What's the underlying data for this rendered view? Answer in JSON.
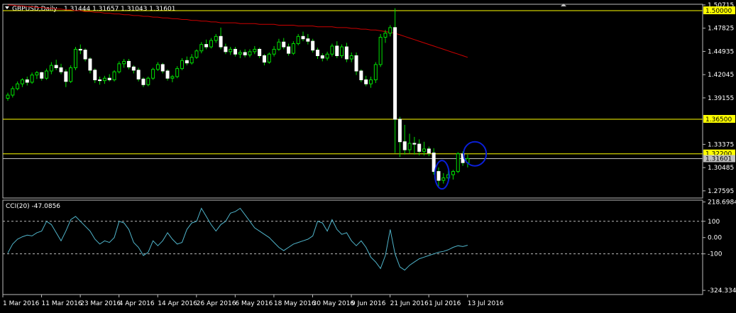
{
  "window": {
    "symbol_tf": "GBPUSD,Daily",
    "ohlc": "1.31444 1.31657 1.31043 1.31601",
    "menu_icon": "triangle-down-icon",
    "scroll_icon": "triangle-up-icon"
  },
  "colors": {
    "background": "#000000",
    "bull": "#ffffff",
    "bear": "#ffffff",
    "wick": "#00e000",
    "ma": "#cc0000",
    "hline": "#ffff00",
    "price_marker_bg": "#c0c0c0",
    "cci": "#4fb3c9",
    "ellipse": "#0a1fd8",
    "grid": "#bbbbbb"
  },
  "chart_data": [
    {
      "type": "candlestick",
      "title": "GBPUSD,Daily",
      "ylim": [
        1.267,
        1.508
      ],
      "y_ticks": [
        "1.50715",
        "1.47825",
        "1.44935",
        "1.42045",
        "1.39155",
        "1.33375",
        "1.30485",
        "1.27595"
      ],
      "price_labels": [
        {
          "value": 1.5,
          "label": "1.50000",
          "style": "yellow-line"
        },
        {
          "value": 1.365,
          "label": "1.36500",
          "style": "yellow-line"
        },
        {
          "value": 1.322,
          "label": "1.32200",
          "style": "yellow-line"
        },
        {
          "value": 1.31601,
          "label": "1.31601",
          "style": "current-price"
        }
      ],
      "x_labels": [
        "1 Mar 2016",
        "11 Mar 2016",
        "23 Mar 2016",
        "4 Apr 2016",
        "14 Apr 2016",
        "26 Apr 2016",
        "6 May 2016",
        "18 May 2016",
        "30 May 2016",
        "9 Jun 2016",
        "21 Jun 2016",
        "1 Jul 2016",
        "13 Jul 2016"
      ],
      "x_label_bar_index": [
        0,
        8,
        16,
        24,
        32,
        40,
        48,
        56,
        64,
        72,
        80,
        88,
        96
      ],
      "candles": [
        [
          1.391,
          1.398,
          1.388,
          1.395
        ],
        [
          1.395,
          1.406,
          1.392,
          1.403
        ],
        [
          1.403,
          1.412,
          1.401,
          1.409
        ],
        [
          1.409,
          1.416,
          1.405,
          1.414
        ],
        [
          1.414,
          1.418,
          1.407,
          1.411
        ],
        [
          1.411,
          1.423,
          1.409,
          1.42
        ],
        [
          1.42,
          1.425,
          1.415,
          1.423
        ],
        [
          1.423,
          1.424,
          1.413,
          1.416
        ],
        [
          1.416,
          1.428,
          1.414,
          1.425
        ],
        [
          1.425,
          1.436,
          1.421,
          1.432
        ],
        [
          1.432,
          1.439,
          1.426,
          1.429
        ],
        [
          1.429,
          1.434,
          1.421,
          1.424
        ],
        [
          1.424,
          1.427,
          1.405,
          1.412
        ],
        [
          1.412,
          1.432,
          1.41,
          1.429
        ],
        [
          1.429,
          1.455,
          1.426,
          1.452
        ],
        [
          1.452,
          1.458,
          1.446,
          1.451
        ],
        [
          1.451,
          1.453,
          1.437,
          1.44
        ],
        [
          1.44,
          1.442,
          1.422,
          1.426
        ],
        [
          1.426,
          1.428,
          1.41,
          1.414
        ],
        [
          1.414,
          1.418,
          1.408,
          1.413
        ],
        [
          1.413,
          1.419,
          1.409,
          1.416
        ],
        [
          1.416,
          1.421,
          1.412,
          1.414
        ],
        [
          1.414,
          1.426,
          1.412,
          1.424
        ],
        [
          1.424,
          1.437,
          1.422,
          1.434
        ],
        [
          1.434,
          1.44,
          1.429,
          1.437
        ],
        [
          1.437,
          1.44,
          1.427,
          1.43
        ],
        [
          1.43,
          1.432,
          1.422,
          1.426
        ],
        [
          1.426,
          1.429,
          1.412,
          1.415
        ],
        [
          1.415,
          1.417,
          1.405,
          1.408
        ],
        [
          1.408,
          1.418,
          1.406,
          1.416
        ],
        [
          1.416,
          1.429,
          1.414,
          1.427
        ],
        [
          1.427,
          1.436,
          1.425,
          1.433
        ],
        [
          1.433,
          1.435,
          1.422,
          1.425
        ],
        [
          1.425,
          1.427,
          1.413,
          1.416
        ],
        [
          1.416,
          1.42,
          1.411,
          1.418
        ],
        [
          1.418,
          1.431,
          1.416,
          1.428
        ],
        [
          1.428,
          1.441,
          1.426,
          1.438
        ],
        [
          1.438,
          1.443,
          1.432,
          1.435
        ],
        [
          1.435,
          1.446,
          1.433,
          1.442
        ],
        [
          1.442,
          1.452,
          1.44,
          1.45
        ],
        [
          1.45,
          1.461,
          1.447,
          1.458
        ],
        [
          1.458,
          1.464,
          1.452,
          1.455
        ],
        [
          1.455,
          1.466,
          1.453,
          1.463
        ],
        [
          1.463,
          1.471,
          1.46,
          1.468
        ],
        [
          1.468,
          1.479,
          1.452,
          1.455
        ],
        [
          1.455,
          1.459,
          1.446,
          1.449
        ],
        [
          1.449,
          1.455,
          1.445,
          1.452
        ],
        [
          1.452,
          1.455,
          1.443,
          1.446
        ],
        [
          1.446,
          1.451,
          1.441,
          1.448
        ],
        [
          1.448,
          1.452,
          1.442,
          1.445
        ],
        [
          1.445,
          1.452,
          1.442,
          1.449
        ],
        [
          1.449,
          1.456,
          1.446,
          1.452
        ],
        [
          1.452,
          1.454,
          1.441,
          1.444
        ],
        [
          1.444,
          1.446,
          1.432,
          1.436
        ],
        [
          1.436,
          1.448,
          1.434,
          1.446
        ],
        [
          1.446,
          1.456,
          1.443,
          1.452
        ],
        [
          1.452,
          1.465,
          1.45,
          1.461
        ],
        [
          1.461,
          1.466,
          1.452,
          1.455
        ],
        [
          1.455,
          1.459,
          1.444,
          1.447
        ],
        [
          1.447,
          1.462,
          1.445,
          1.459
        ],
        [
          1.459,
          1.471,
          1.457,
          1.468
        ],
        [
          1.468,
          1.474,
          1.462,
          1.465
        ],
        [
          1.465,
          1.471,
          1.458,
          1.462
        ],
        [
          1.462,
          1.465,
          1.448,
          1.451
        ],
        [
          1.451,
          1.454,
          1.44,
          1.444
        ],
        [
          1.444,
          1.447,
          1.437,
          1.441
        ],
        [
          1.441,
          1.449,
          1.438,
          1.446
        ],
        [
          1.446,
          1.459,
          1.443,
          1.456
        ],
        [
          1.456,
          1.462,
          1.441,
          1.444
        ],
        [
          1.444,
          1.458,
          1.441,
          1.455
        ],
        [
          1.455,
          1.46,
          1.436,
          1.44
        ],
        [
          1.44,
          1.448,
          1.436,
          1.444
        ],
        [
          1.444,
          1.448,
          1.42,
          1.425
        ],
        [
          1.425,
          1.427,
          1.411,
          1.414
        ],
        [
          1.414,
          1.419,
          1.406,
          1.409
        ],
        [
          1.409,
          1.418,
          1.404,
          1.414
        ],
        [
          1.414,
          1.436,
          1.41,
          1.433
        ],
        [
          1.433,
          1.471,
          1.43,
          1.467
        ],
        [
          1.467,
          1.476,
          1.46,
          1.472
        ],
        [
          1.472,
          1.482,
          1.468,
          1.479
        ],
        [
          1.479,
          1.503,
          1.323,
          1.365
        ],
        [
          1.365,
          1.368,
          1.318,
          1.337
        ],
        [
          1.337,
          1.358,
          1.321,
          1.327
        ],
        [
          1.327,
          1.347,
          1.322,
          1.335
        ],
        [
          1.335,
          1.343,
          1.321,
          1.334
        ],
        [
          1.334,
          1.34,
          1.32,
          1.325
        ],
        [
          1.325,
          1.337,
          1.32,
          1.328
        ],
        [
          1.328,
          1.331,
          1.319,
          1.323
        ],
        [
          1.323,
          1.329,
          1.296,
          1.3
        ],
        [
          1.3,
          1.305,
          1.281,
          1.289
        ],
        [
          1.289,
          1.298,
          1.285,
          1.292
        ],
        [
          1.292,
          1.301,
          1.288,
          1.296
        ],
        [
          1.296,
          1.302,
          1.29,
          1.3
        ],
        [
          1.3,
          1.324,
          1.298,
          1.322
        ],
        [
          1.322,
          1.325,
          1.307,
          1.311
        ],
        [
          1.311,
          1.321,
          1.305,
          1.316
        ]
      ],
      "ma_series": {
        "name": "",
        "values": [
          1.507,
          1.507,
          1.506,
          1.506,
          1.505,
          1.505,
          1.504,
          1.504,
          1.503,
          1.503,
          1.502,
          1.502,
          1.501,
          1.501,
          1.5,
          1.5,
          1.499,
          1.499,
          1.498,
          1.498,
          1.497,
          1.497,
          1.496,
          1.496,
          1.495,
          1.495,
          1.494,
          1.494,
          1.493,
          1.493,
          1.492,
          1.492,
          1.491,
          1.491,
          1.49,
          1.49,
          1.489,
          1.489,
          1.488,
          1.488,
          1.487,
          1.487,
          1.486,
          1.486,
          1.485,
          1.485,
          1.485,
          1.485,
          1.484,
          1.484,
          1.484,
          1.484,
          1.483,
          1.483,
          1.483,
          1.483,
          1.482,
          1.482,
          1.482,
          1.482,
          1.481,
          1.481,
          1.481,
          1.481,
          1.48,
          1.48,
          1.48,
          1.48,
          1.479,
          1.479,
          1.479,
          1.478,
          1.478,
          1.477,
          1.477,
          1.476,
          1.476,
          1.475,
          1.474,
          1.473,
          1.472,
          1.47,
          1.468,
          1.466,
          1.464,
          1.462,
          1.46,
          1.458,
          1.456,
          1.454,
          1.452,
          1.45,
          1.448,
          1.446,
          1.444,
          1.442
        ]
      },
      "highlights": [
        {
          "bar_index": 89.7,
          "price": 1.296,
          "label": ""
        },
        {
          "bar_index": 96.5,
          "price": 1.322,
          "label": ""
        }
      ]
    },
    {
      "type": "line",
      "title": "CCI(20) -47.0856",
      "ylim": [
        -350,
        230
      ],
      "y_ticks": [
        {
          "value": 218.6984,
          "label": "218.6984"
        },
        {
          "value": 100,
          "label": "100"
        },
        {
          "value": 0,
          "label": "0.00"
        },
        {
          "value": -100,
          "label": "-100"
        },
        {
          "value": -324.3348,
          "label": "-324.3348"
        }
      ],
      "levels": [
        100,
        -100
      ],
      "series": [
        {
          "name": "",
          "values": [
            -95,
            -40,
            -10,
            5,
            15,
            10,
            30,
            40,
            100,
            80,
            30,
            -20,
            40,
            110,
            130,
            100,
            70,
            40,
            -10,
            -40,
            -20,
            -30,
            0,
            100,
            90,
            50,
            -30,
            -60,
            -110,
            -90,
            -20,
            -50,
            -20,
            30,
            -10,
            -40,
            -30,
            50,
            90,
            100,
            180,
            130,
            80,
            40,
            80,
            100,
            150,
            160,
            180,
            140,
            100,
            60,
            40,
            20,
            0,
            -30,
            -60,
            -80,
            -60,
            -40,
            -30,
            -20,
            -10,
            10,
            100,
            90,
            40,
            110,
            50,
            20,
            30,
            -20,
            -50,
            -20,
            -60,
            -120,
            -150,
            -190,
            -110,
            50,
            -100,
            -180,
            -200,
            -170,
            -150,
            -130,
            -120,
            -110,
            -100,
            -90,
            -85,
            -75,
            -60,
            -50,
            -55,
            -47
          ]
        }
      ]
    }
  ]
}
